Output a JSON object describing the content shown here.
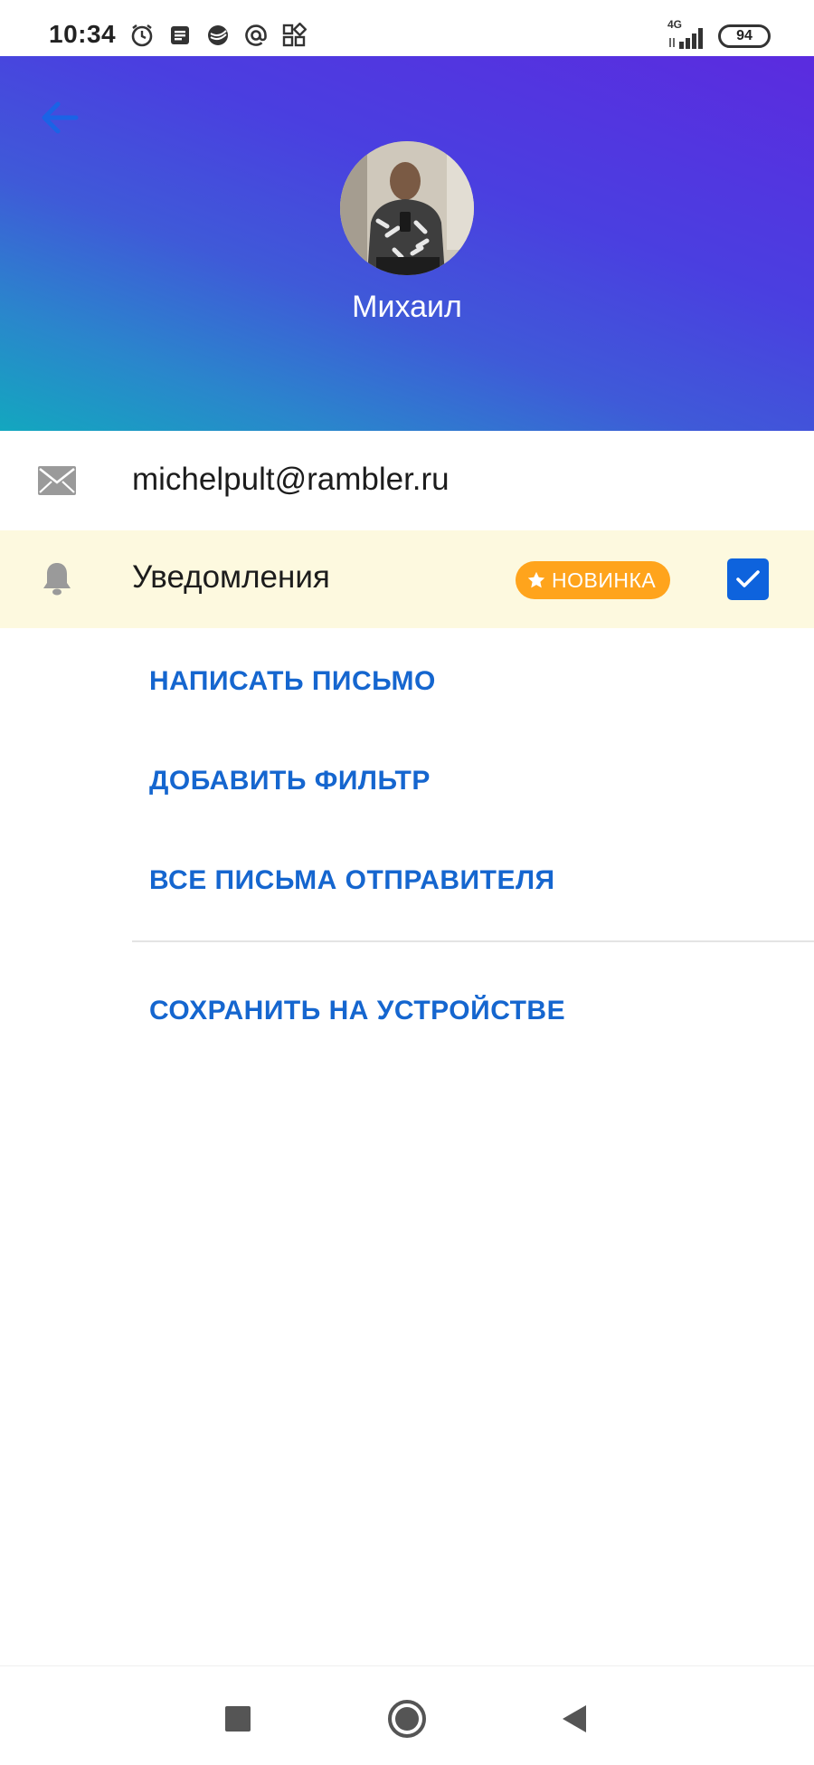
{
  "status_bar": {
    "time": "10:34",
    "network": "4G",
    "battery": "94",
    "icons": [
      "alarm-icon",
      "news-icon",
      "sber-icon",
      "at-icon",
      "apps-icon"
    ]
  },
  "header": {
    "back_icon": "arrow-left-icon",
    "contact_name": "Михаил",
    "gradient_colors": [
      "#5b2bdf",
      "#3f5ad8",
      "#13a7bf"
    ]
  },
  "email_row": {
    "icon": "mail-icon",
    "email": "michelpult@rambler.ru"
  },
  "notifications_row": {
    "icon": "bell-icon",
    "label": "Уведомления",
    "badge": "НОВИНКА",
    "checked": true
  },
  "actions": {
    "write_letter": "НАПИСАТЬ ПИСЬМО",
    "add_filter": "ДОБАВИТЬ ФИЛЬТР",
    "all_sender_letters": "ВСЕ ПИСЬМА ОТПРАВИТЕЛЯ",
    "save_on_device": "СОХРАНИТЬ НА УСТРОЙСТВЕ"
  },
  "colors": {
    "accent": "#1566cf",
    "badge": "#ffa41c",
    "checkbox": "#0e63dd",
    "highlight_row": "#fdf9df"
  },
  "nav_bar": {
    "icons": [
      "recents-square-icon",
      "home-circle-icon",
      "back-triangle-icon"
    ]
  }
}
